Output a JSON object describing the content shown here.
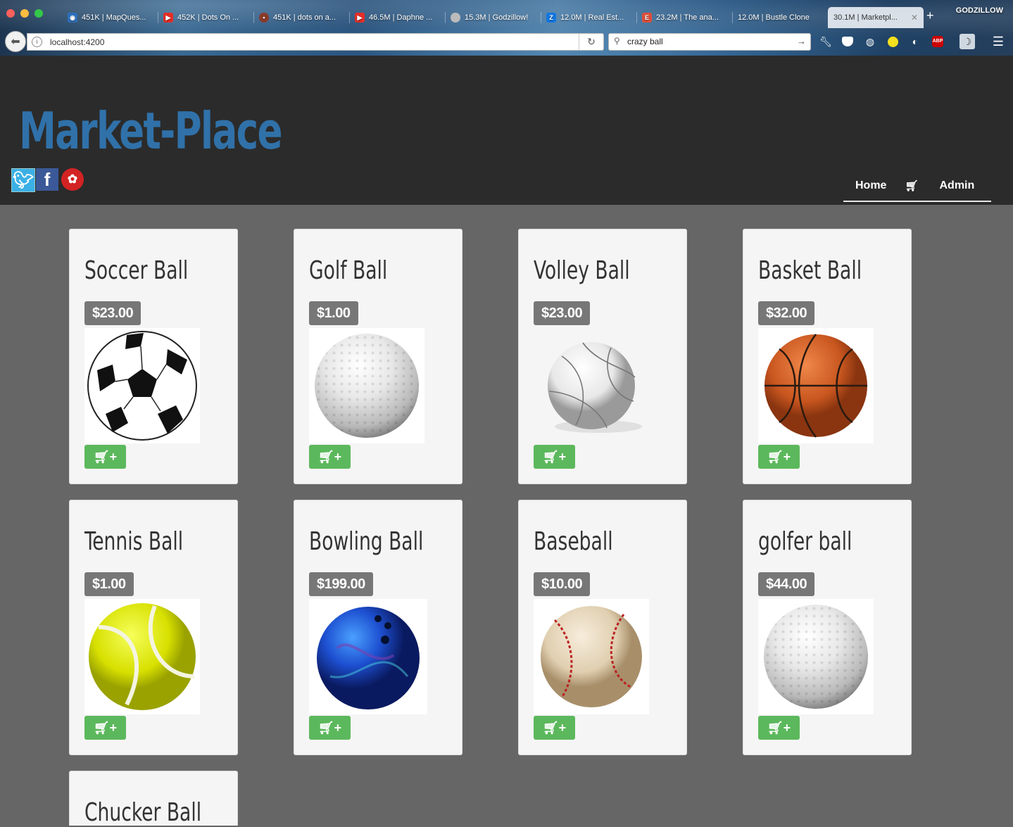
{
  "browser": {
    "tabs": [
      {
        "title": "451K | MapQues...",
        "icon": "mapquest-icon",
        "color": "#2d6fbf"
      },
      {
        "title": "452K | Dots On ...",
        "icon": "youtube-icon",
        "color": "#e52d27"
      },
      {
        "title": "451K | dots on a...",
        "icon": "ladybug-icon",
        "color": "#8a3a2a"
      },
      {
        "title": "46.5M | Daphne ...",
        "icon": "youtube-icon",
        "color": "#e52d27"
      },
      {
        "title": "15.3M | Godzillow!",
        "icon": "godzilla-icon",
        "color": "#bbbbbb"
      },
      {
        "title": "12.0M | Real Est...",
        "icon": "zillow-icon",
        "color": "#1277e1"
      },
      {
        "title": "23.2M | The ana...",
        "icon": "ember-icon",
        "color": "#e04e39"
      },
      {
        "title": "12.0M | Bustle Clone",
        "icon": "",
        "color": ""
      },
      {
        "title": "30.1M | Marketpl...",
        "icon": "",
        "color": ""
      }
    ],
    "profile": "GODZILLOW",
    "url": "localhost:4200",
    "search_value": "crazy ball"
  },
  "site": {
    "title": "Market-Place",
    "nav": {
      "home": "Home",
      "admin": "Admin"
    }
  },
  "products": [
    {
      "name": "Soccer Ball",
      "price": "$23.00",
      "image": "soccer"
    },
    {
      "name": "Golf Ball",
      "price": "$1.00",
      "image": "golf"
    },
    {
      "name": "Volley Ball",
      "price": "$23.00",
      "image": "volley"
    },
    {
      "name": "Basket Ball",
      "price": "$32.00",
      "image": "basket"
    },
    {
      "name": "Tennis Ball",
      "price": "$1.00",
      "image": "tennis"
    },
    {
      "name": "Bowling Ball",
      "price": "$199.00",
      "image": "bowling"
    },
    {
      "name": "Baseball",
      "price": "$10.00",
      "image": "baseball"
    },
    {
      "name": "golfer ball",
      "price": "$44.00",
      "image": "golf"
    },
    {
      "name": "Chucker Ball",
      "price": "",
      "image": ""
    }
  ],
  "colors": {
    "brand": "#3071a9",
    "header_bg": "#2b2b2b",
    "page_bg": "#666666",
    "price_badge": "#777777",
    "add_button": "#5cb85c"
  }
}
